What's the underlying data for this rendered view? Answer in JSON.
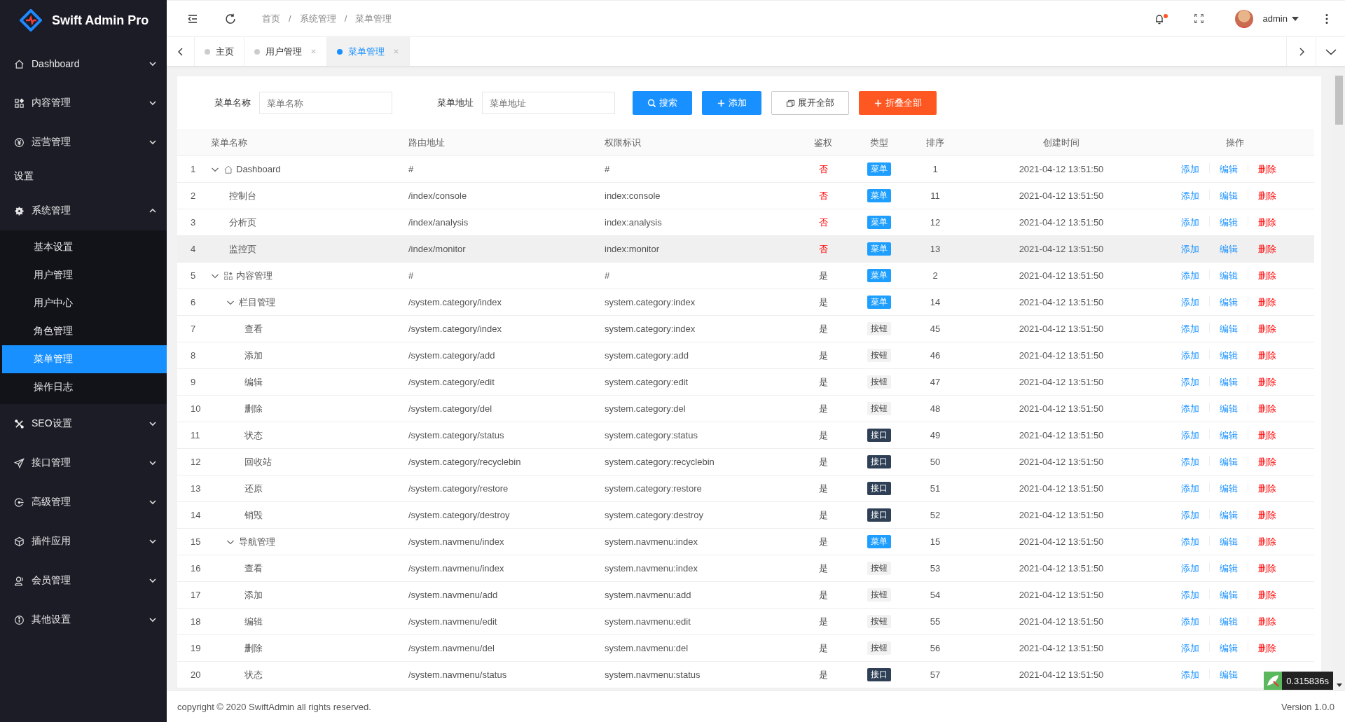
{
  "brand": {
    "name": "Swift Admin Pro"
  },
  "sidebar": {
    "items": [
      {
        "kind": "menu",
        "label": "Dashboard",
        "expanded": false
      },
      {
        "kind": "menu",
        "label": "内容管理",
        "expanded": false
      },
      {
        "kind": "menu",
        "label": "运营管理",
        "expanded": false
      },
      {
        "kind": "heading",
        "label": "设置"
      },
      {
        "kind": "menu",
        "label": "系统管理",
        "expanded": true,
        "children": [
          {
            "label": "基本设置",
            "selected": false
          },
          {
            "label": "用户管理",
            "selected": false
          },
          {
            "label": "用户中心",
            "selected": false
          },
          {
            "label": "角色管理",
            "selected": false
          },
          {
            "label": "菜单管理",
            "selected": true
          },
          {
            "label": "操作日志",
            "selected": false
          }
        ]
      },
      {
        "kind": "menu",
        "label": "SEO设置",
        "expanded": false
      },
      {
        "kind": "menu",
        "label": "接口管理",
        "expanded": false
      },
      {
        "kind": "menu",
        "label": "高级管理",
        "expanded": false
      },
      {
        "kind": "menu",
        "label": "插件应用",
        "expanded": false
      },
      {
        "kind": "menu",
        "label": "会员管理",
        "expanded": false
      },
      {
        "kind": "menu",
        "label": "其他设置",
        "expanded": false
      }
    ]
  },
  "header": {
    "breadcrumb": [
      {
        "label": "首页",
        "sep": "/"
      },
      {
        "label": "系统管理",
        "sep": "/"
      },
      {
        "label": "菜单管理"
      }
    ],
    "has_unread": true,
    "user": "admin"
  },
  "tabs": [
    {
      "label": "主页",
      "closable": false,
      "selected": false
    },
    {
      "label": "用户管理",
      "closable": true,
      "selected": false
    },
    {
      "label": "菜单管理",
      "closable": true,
      "selected": true
    }
  ],
  "search": {
    "fields": [
      {
        "label": "菜单名称",
        "placeholder": "菜单名称"
      },
      {
        "label": "菜单地址",
        "placeholder": "菜单地址"
      }
    ],
    "buttons": [
      {
        "label": "搜索",
        "kind": "primary"
      },
      {
        "label": "添加",
        "kind": "primary"
      },
      {
        "label": "展开全部",
        "kind": "default"
      },
      {
        "label": "折叠全部",
        "kind": "danger"
      }
    ]
  },
  "table": {
    "columns": [
      "菜单名称",
      "路由地址",
      "权限标识",
      "鉴权",
      "类型",
      "排序",
      "创建时间",
      "操作"
    ],
    "rows": [
      {
        "no": "1",
        "name": "Dashboard",
        "route": "#",
        "perm": "#",
        "auth": "否",
        "auth_on": false,
        "type": {
          "kind": "menu",
          "label": "菜单"
        },
        "sort": "1",
        "time": "2021-04-12 13:51:50",
        "actions": [
          "添加",
          "编辑",
          "删除"
        ],
        "highlighted": false,
        "expanded": true,
        "children": [
          {
            "no": "2",
            "name": "控制台",
            "route": "/index/console",
            "perm": "index:console",
            "auth": "否",
            "auth_on": false,
            "type": {
              "kind": "menu",
              "label": "菜单"
            },
            "sort": "11",
            "time": "2021-04-12 13:51:50",
            "actions": [
              "添加",
              "编辑",
              "删除"
            ],
            "highlighted": false
          },
          {
            "no": "3",
            "name": "分析页",
            "route": "/index/analysis",
            "perm": "index:analysis",
            "auth": "否",
            "auth_on": false,
            "type": {
              "kind": "menu",
              "label": "菜单"
            },
            "sort": "12",
            "time": "2021-04-12 13:51:50",
            "actions": [
              "添加",
              "编辑",
              "删除"
            ],
            "highlighted": false
          },
          {
            "no": "4",
            "name": "监控页",
            "route": "/index/monitor",
            "perm": "index:monitor",
            "auth": "否",
            "auth_on": false,
            "type": {
              "kind": "menu",
              "label": "菜单"
            },
            "sort": "13",
            "time": "2021-04-12 13:51:50",
            "actions": [
              "添加",
              "编辑",
              "删除"
            ],
            "highlighted": true
          }
        ]
      },
      {
        "no": "5",
        "name": "内容管理",
        "route": "#",
        "perm": "#",
        "auth": "是",
        "auth_on": true,
        "type": {
          "kind": "menu",
          "label": "菜单"
        },
        "sort": "2",
        "time": "2021-04-12 13:51:50",
        "actions": [
          "添加",
          "编辑",
          "删除"
        ],
        "highlighted": false,
        "expanded": true,
        "children": [
          {
            "no": "6",
            "name": "栏目管理",
            "route": "/system.category/index",
            "perm": "system.category:index",
            "auth": "是",
            "auth_on": true,
            "type": {
              "kind": "menu",
              "label": "菜单"
            },
            "sort": "14",
            "time": "2021-04-12 13:51:50",
            "actions": [
              "添加",
              "编辑",
              "删除"
            ],
            "highlighted": false,
            "expanded": true,
            "children": [
              {
                "no": "7",
                "name": "查看",
                "route": "/system.category/index",
                "perm": "system.category:index",
                "auth": "是",
                "auth_on": true,
                "type": {
                  "kind": "button",
                  "label": "按钮"
                },
                "sort": "45",
                "time": "2021-04-12 13:51:50",
                "actions": [
                  "添加",
                  "编辑",
                  "删除"
                ],
                "highlighted": false
              },
              {
                "no": "8",
                "name": "添加",
                "route": "/system.category/add",
                "perm": "system.category:add",
                "auth": "是",
                "auth_on": true,
                "type": {
                  "kind": "button",
                  "label": "按钮"
                },
                "sort": "46",
                "time": "2021-04-12 13:51:50",
                "actions": [
                  "添加",
                  "编辑",
                  "删除"
                ],
                "highlighted": false
              },
              {
                "no": "9",
                "name": "编辑",
                "route": "/system.category/edit",
                "perm": "system.category:edit",
                "auth": "是",
                "auth_on": true,
                "type": {
                  "kind": "button",
                  "label": "按钮"
                },
                "sort": "47",
                "time": "2021-04-12 13:51:50",
                "actions": [
                  "添加",
                  "编辑",
                  "删除"
                ],
                "highlighted": false
              },
              {
                "no": "10",
                "name": "删除",
                "route": "/system.category/del",
                "perm": "system.category:del",
                "auth": "是",
                "auth_on": true,
                "type": {
                  "kind": "button",
                  "label": "按钮"
                },
                "sort": "48",
                "time": "2021-04-12 13:51:50",
                "actions": [
                  "添加",
                  "编辑",
                  "删除"
                ],
                "highlighted": false
              },
              {
                "no": "11",
                "name": "状态",
                "route": "/system.category/status",
                "perm": "system.category:status",
                "auth": "是",
                "auth_on": true,
                "type": {
                  "kind": "api",
                  "label": "接口"
                },
                "sort": "49",
                "time": "2021-04-12 13:51:50",
                "actions": [
                  "添加",
                  "编辑",
                  "删除"
                ],
                "highlighted": false
              },
              {
                "no": "12",
                "name": "回收站",
                "route": "/system.category/recyclebin",
                "perm": "system.category:recyclebin",
                "auth": "是",
                "auth_on": true,
                "type": {
                  "kind": "api",
                  "label": "接口"
                },
                "sort": "50",
                "time": "2021-04-12 13:51:50",
                "actions": [
                  "添加",
                  "编辑",
                  "删除"
                ],
                "highlighted": false
              },
              {
                "no": "13",
                "name": "还原",
                "route": "/system.category/restore",
                "perm": "system.category:restore",
                "auth": "是",
                "auth_on": true,
                "type": {
                  "kind": "api",
                  "label": "接口"
                },
                "sort": "51",
                "time": "2021-04-12 13:51:50",
                "actions": [
                  "添加",
                  "编辑",
                  "删除"
                ],
                "highlighted": false
              },
              {
                "no": "14",
                "name": "销毁",
                "route": "/system.category/destroy",
                "perm": "system.category:destroy",
                "auth": "是",
                "auth_on": true,
                "type": {
                  "kind": "api",
                  "label": "接口"
                },
                "sort": "52",
                "time": "2021-04-12 13:51:50",
                "actions": [
                  "添加",
                  "编辑",
                  "删除"
                ],
                "highlighted": false
              }
            ]
          },
          {
            "no": "15",
            "name": "导航管理",
            "route": "/system.navmenu/index",
            "perm": "system.navmenu:index",
            "auth": "是",
            "auth_on": true,
            "type": {
              "kind": "menu",
              "label": "菜单"
            },
            "sort": "15",
            "time": "2021-04-12 13:51:50",
            "actions": [
              "添加",
              "编辑",
              "删除"
            ],
            "highlighted": false,
            "expanded": true,
            "children": [
              {
                "no": "16",
                "name": "查看",
                "route": "/system.navmenu/index",
                "perm": "system.navmenu:index",
                "auth": "是",
                "auth_on": true,
                "type": {
                  "kind": "button",
                  "label": "按钮"
                },
                "sort": "53",
                "time": "2021-04-12 13:51:50",
                "actions": [
                  "添加",
                  "编辑",
                  "删除"
                ],
                "highlighted": false
              },
              {
                "no": "17",
                "name": "添加",
                "route": "/system.navmenu/add",
                "perm": "system.navmenu:add",
                "auth": "是",
                "auth_on": true,
                "type": {
                  "kind": "button",
                  "label": "按钮"
                },
                "sort": "54",
                "time": "2021-04-12 13:51:50",
                "actions": [
                  "添加",
                  "编辑",
                  "删除"
                ],
                "highlighted": false
              },
              {
                "no": "18",
                "name": "编辑",
                "route": "/system.navmenu/edit",
                "perm": "system.navmenu:edit",
                "auth": "是",
                "auth_on": true,
                "type": {
                  "kind": "button",
                  "label": "按钮"
                },
                "sort": "55",
                "time": "2021-04-12 13:51:50",
                "actions": [
                  "添加",
                  "编辑",
                  "删除"
                ],
                "highlighted": false
              },
              {
                "no": "19",
                "name": "删除",
                "route": "/system.navmenu/del",
                "perm": "system.navmenu:del",
                "auth": "是",
                "auth_on": true,
                "type": {
                  "kind": "button",
                  "label": "按钮"
                },
                "sort": "56",
                "time": "2021-04-12 13:51:50",
                "actions": [
                  "添加",
                  "编辑",
                  "删除"
                ],
                "highlighted": false
              },
              {
                "no": "20",
                "name": "状态",
                "route": "/system.navmenu/status",
                "perm": "system.navmenu:status",
                "auth": "是",
                "auth_on": true,
                "type": {
                  "kind": "api",
                  "label": "接口"
                },
                "sort": "57",
                "time": "2021-04-12 13:51:50",
                "actions": [
                  "添加",
                  "编辑"
                ],
                "highlighted": false
              }
            ]
          }
        ]
      }
    ]
  },
  "trace_badge": {
    "text": "0.315836s"
  },
  "footer": {
    "copyright": "copyright © 2020 SwiftAdmin all rights reserved.",
    "version": "Version 1.0.0"
  }
}
